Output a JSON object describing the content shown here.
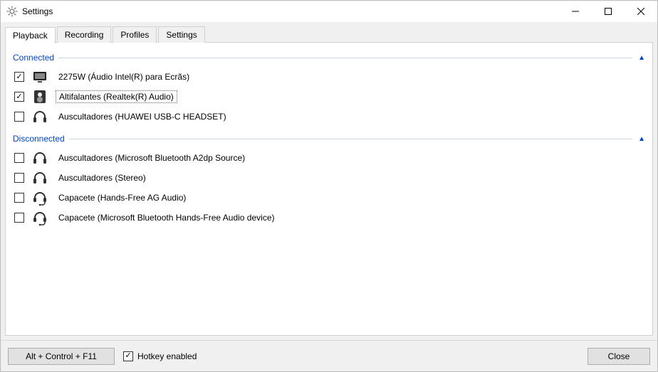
{
  "window": {
    "title": "Settings"
  },
  "tabs": [
    {
      "label": "Playback",
      "active": true
    },
    {
      "label": "Recording",
      "active": false
    },
    {
      "label": "Profiles",
      "active": false
    },
    {
      "label": "Settings",
      "active": false
    }
  ],
  "groups": {
    "connected": {
      "label": "Connected",
      "expanded": true,
      "devices": [
        {
          "checked": true,
          "icon": "monitor",
          "label": "2275W (Áudio Intel(R) para Ecrãs)",
          "selected": false
        },
        {
          "checked": true,
          "icon": "speaker",
          "label": "Altifalantes (Realtek(R) Audio)",
          "selected": true
        },
        {
          "checked": false,
          "icon": "headphones",
          "label": "Auscultadores (HUAWEI USB-C HEADSET)",
          "selected": false
        }
      ]
    },
    "disconnected": {
      "label": "Disconnected",
      "expanded": true,
      "devices": [
        {
          "checked": false,
          "icon": "headphones",
          "label": "Auscultadores (Microsoft Bluetooth A2dp Source)",
          "selected": false
        },
        {
          "checked": false,
          "icon": "headphones",
          "label": "Auscultadores (Stereo)",
          "selected": false
        },
        {
          "checked": false,
          "icon": "headset",
          "label": "Capacete (Hands-Free AG Audio)",
          "selected": false
        },
        {
          "checked": false,
          "icon": "headset",
          "label": "Capacete (Microsoft Bluetooth Hands-Free Audio device)",
          "selected": false
        }
      ]
    }
  },
  "footer": {
    "hotkey_value": "Alt + Control + F11",
    "hotkey_enabled_label": "Hotkey enabled",
    "hotkey_enabled_checked": true,
    "close_label": "Close"
  }
}
